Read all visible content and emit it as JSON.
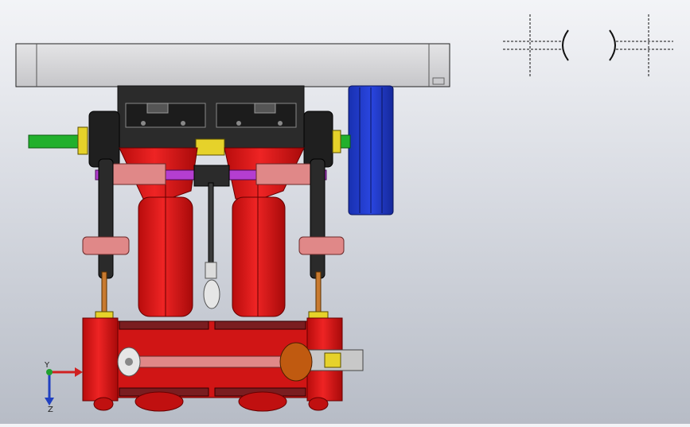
{
  "app": {
    "title": ""
  },
  "viewport": {
    "view": "front",
    "render_style": "shaded with edges"
  },
  "model": {
    "parts": [
      {
        "name": "top-plate",
        "color": "#d4d4d6"
      },
      {
        "name": "upper-block",
        "color": "#2a2a2a"
      },
      {
        "name": "cylinder-bodies",
        "color": "#e01818"
      },
      {
        "name": "flywheel",
        "color": "#1c2fc8"
      },
      {
        "name": "output-shaft",
        "color": "#1fa82a"
      },
      {
        "name": "crossbar",
        "color": "#b43ed0"
      },
      {
        "name": "rocker-arms",
        "color": "#e08888"
      },
      {
        "name": "brass-rings",
        "color": "#e6d22a"
      },
      {
        "name": "push-rods",
        "color": "#c87a30"
      },
      {
        "name": "crosshead",
        "color": "#c05a10"
      }
    ]
  },
  "triad": {
    "x_label": "",
    "y_label": "Y",
    "z_label": "Z"
  },
  "annotations": {
    "symbols": [
      "weld-symbol-left",
      "weld-symbol-right"
    ]
  }
}
